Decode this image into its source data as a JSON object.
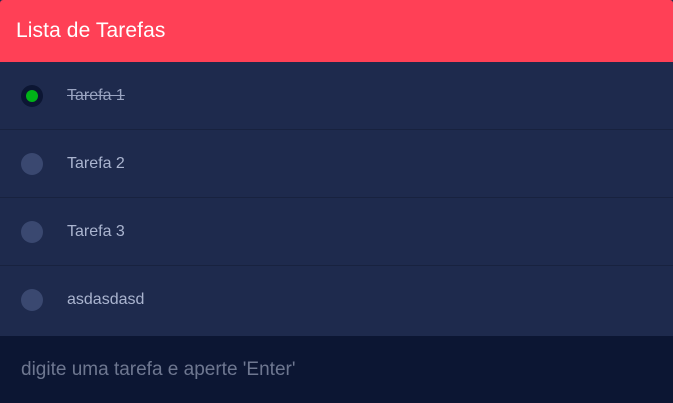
{
  "header": {
    "title": "Lista de Tarefas"
  },
  "tasks": [
    {
      "label": "Tarefa 1",
      "completed": true
    },
    {
      "label": "Tarefa 2",
      "completed": false
    },
    {
      "label": "Tarefa 3",
      "completed": false
    },
    {
      "label": "asdasdasd",
      "completed": false
    }
  ],
  "input": {
    "value": "",
    "placeholder": "digite uma tarefa e aperte 'Enter'"
  },
  "colors": {
    "header_bg": "#ff4056",
    "body_bg": "#1e2a4d",
    "input_bg": "#0c1633",
    "check_green": "#00b318"
  }
}
